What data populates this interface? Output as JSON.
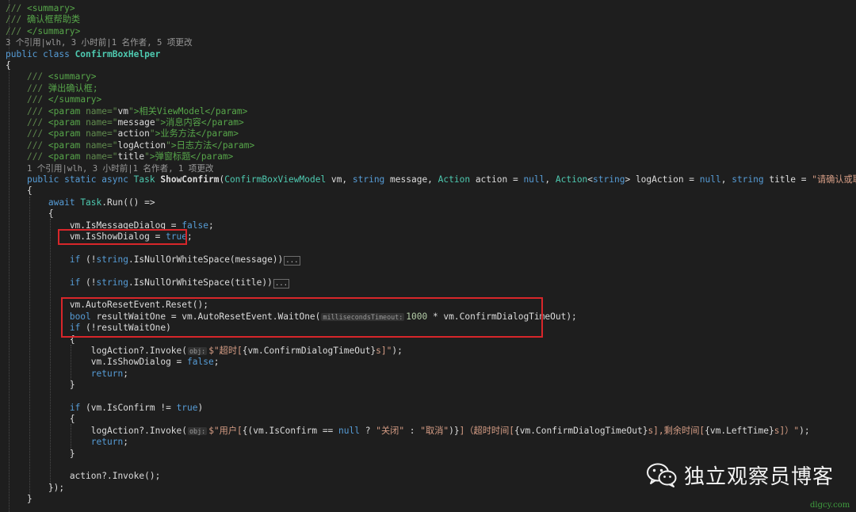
{
  "code_lines": [
    [
      {
        "c": "dt",
        "t": "/// "
      },
      {
        "c": "cm",
        "t": "<summary>"
      }
    ],
    [
      {
        "c": "dt",
        "t": "/// "
      },
      {
        "c": "cm",
        "t": "确认框帮助类"
      }
    ],
    [
      {
        "c": "dt",
        "t": "/// "
      },
      {
        "c": "cm",
        "t": "</summary>"
      }
    ],
    [
      {
        "c": "ref",
        "t": "3 个引用|wlh, 3 小时前|1 名作者, 5 项更改"
      }
    ],
    [
      {
        "c": "kw",
        "t": "public class "
      },
      {
        "c": "cls",
        "t": "ConfirmBoxHelper"
      }
    ],
    [
      {
        "c": "tx",
        "t": "{"
      }
    ],
    [
      {
        "c": "tx",
        "t": "    "
      },
      {
        "c": "dt",
        "t": "/// "
      },
      {
        "c": "cm",
        "t": "<summary>"
      }
    ],
    [
      {
        "c": "tx",
        "t": "    "
      },
      {
        "c": "dt",
        "t": "/// "
      },
      {
        "c": "cm",
        "t": "弹出确认框;"
      }
    ],
    [
      {
        "c": "tx",
        "t": "    "
      },
      {
        "c": "dt",
        "t": "/// "
      },
      {
        "c": "cm",
        "t": "</summary>"
      }
    ],
    [
      {
        "c": "tx",
        "t": "    "
      },
      {
        "c": "dt",
        "t": "/// "
      },
      {
        "c": "cm",
        "t": "<param "
      },
      {
        "c": "dt",
        "t": "name=\""
      },
      {
        "c": "tx",
        "t": "vm"
      },
      {
        "c": "dt",
        "t": "\""
      },
      {
        "c": "cm",
        "t": ">相关ViewModel</param>"
      }
    ],
    [
      {
        "c": "tx",
        "t": "    "
      },
      {
        "c": "dt",
        "t": "/// "
      },
      {
        "c": "cm",
        "t": "<param "
      },
      {
        "c": "dt",
        "t": "name=\""
      },
      {
        "c": "tx",
        "t": "message"
      },
      {
        "c": "dt",
        "t": "\""
      },
      {
        "c": "cm",
        "t": ">消息内容</param>"
      }
    ],
    [
      {
        "c": "tx",
        "t": "    "
      },
      {
        "c": "dt",
        "t": "/// "
      },
      {
        "c": "cm",
        "t": "<param "
      },
      {
        "c": "dt",
        "t": "name=\""
      },
      {
        "c": "tx",
        "t": "action"
      },
      {
        "c": "dt",
        "t": "\""
      },
      {
        "c": "cm",
        "t": ">业务方法</param>"
      }
    ],
    [
      {
        "c": "tx",
        "t": "    "
      },
      {
        "c": "dt",
        "t": "/// "
      },
      {
        "c": "cm",
        "t": "<param "
      },
      {
        "c": "dt",
        "t": "name=\""
      },
      {
        "c": "tx",
        "t": "logAction"
      },
      {
        "c": "dt",
        "t": "\""
      },
      {
        "c": "cm",
        "t": ">日志方法</param>"
      }
    ],
    [
      {
        "c": "tx",
        "t": "    "
      },
      {
        "c": "dt",
        "t": "/// "
      },
      {
        "c": "cm",
        "t": "<param "
      },
      {
        "c": "dt",
        "t": "name=\""
      },
      {
        "c": "tx",
        "t": "title"
      },
      {
        "c": "dt",
        "t": "\""
      },
      {
        "c": "cm",
        "t": ">弹窗标题</param>"
      }
    ],
    [
      {
        "c": "tx",
        "t": "    "
      },
      {
        "c": "ref",
        "t": "1 个引用|wlh, 3 小时前|1 名作者, 1 项更改"
      }
    ],
    [
      {
        "c": "tx",
        "t": "    "
      },
      {
        "c": "kw",
        "t": "public static async "
      },
      {
        "c": "ty",
        "t": "Task "
      },
      {
        "c": "mb",
        "t": "ShowConfirm"
      },
      {
        "c": "tx",
        "t": "("
      },
      {
        "c": "ty",
        "t": "ConfirmBoxViewModel"
      },
      {
        "c": "tx",
        "t": " vm, "
      },
      {
        "c": "kw",
        "t": "string"
      },
      {
        "c": "tx",
        "t": " message, "
      },
      {
        "c": "ty",
        "t": "Action"
      },
      {
        "c": "tx",
        "t": " action = "
      },
      {
        "c": "kw",
        "t": "null"
      },
      {
        "c": "tx",
        "t": ", "
      },
      {
        "c": "ty",
        "t": "Action"
      },
      {
        "c": "tx",
        "t": "<"
      },
      {
        "c": "kw",
        "t": "string"
      },
      {
        "c": "tx",
        "t": "> logAction = "
      },
      {
        "c": "kw",
        "t": "null"
      },
      {
        "c": "tx",
        "t": ", "
      },
      {
        "c": "kw",
        "t": "string"
      },
      {
        "c": "tx",
        "t": " title = "
      },
      {
        "c": "st",
        "t": "\"请确认或取消\""
      },
      {
        "c": "tx",
        "t": ")"
      }
    ],
    [
      {
        "c": "tx",
        "t": "    {"
      }
    ],
    [
      {
        "c": "tx",
        "t": "        "
      },
      {
        "c": "kw",
        "t": "await "
      },
      {
        "c": "ty",
        "t": "Task"
      },
      {
        "c": "tx",
        "t": ".Run(() =>"
      }
    ],
    [
      {
        "c": "tx",
        "t": "        {"
      }
    ],
    [
      {
        "c": "tx",
        "t": "            vm.IsMessageDialog = "
      },
      {
        "c": "kw",
        "t": "false"
      },
      {
        "c": "tx",
        "t": ";"
      }
    ],
    [
      {
        "c": "tx",
        "t": "            vm.IsShowDialog = "
      },
      {
        "c": "kw",
        "t": "true"
      },
      {
        "c": "tx",
        "t": ";"
      }
    ],
    [],
    [
      {
        "c": "tx",
        "t": "            "
      },
      {
        "c": "kw",
        "t": "if"
      },
      {
        "c": "tx",
        "t": " (!"
      },
      {
        "c": "kw",
        "t": "string"
      },
      {
        "c": "tx",
        "t": ".IsNullOrWhiteSpace(message))"
      },
      {
        "c": "col",
        "t": "..."
      }
    ],
    [],
    [
      {
        "c": "tx",
        "t": "            "
      },
      {
        "c": "kw",
        "t": "if"
      },
      {
        "c": "tx",
        "t": " (!"
      },
      {
        "c": "kw",
        "t": "string"
      },
      {
        "c": "tx",
        "t": ".IsNullOrWhiteSpace(title))"
      },
      {
        "c": "col",
        "t": "..."
      }
    ],
    [],
    [
      {
        "c": "tx",
        "t": "            vm.AutoResetEvent.Reset();"
      }
    ],
    [
      {
        "c": "tx",
        "t": "            "
      },
      {
        "c": "kw",
        "t": "bool"
      },
      {
        "c": "tx",
        "t": " resultWaitOne = vm.AutoResetEvent.WaitOne("
      },
      {
        "c": "hint",
        "t": "millisecondsTimeout:"
      },
      {
        "c": "nu",
        "t": "1000"
      },
      {
        "c": "tx",
        "t": " * vm.ConfirmDialogTimeOut);"
      }
    ],
    [
      {
        "c": "tx",
        "t": "            "
      },
      {
        "c": "kw",
        "t": "if"
      },
      {
        "c": "tx",
        "t": " (!resultWaitOne)"
      }
    ],
    [
      {
        "c": "tx",
        "t": "            {"
      }
    ],
    [
      {
        "c": "tx",
        "t": "                logAction?.Invoke("
      },
      {
        "c": "hint",
        "t": "obj:"
      },
      {
        "c": "st",
        "t": "$\"超时["
      },
      {
        "c": "tx",
        "t": "{vm.ConfirmDialogTimeOut}"
      },
      {
        "c": "st",
        "t": "s]\""
      },
      {
        "c": "tx",
        "t": ");"
      }
    ],
    [
      {
        "c": "tx",
        "t": "                vm.IsShowDialog = "
      },
      {
        "c": "kw",
        "t": "false"
      },
      {
        "c": "tx",
        "t": ";"
      }
    ],
    [
      {
        "c": "tx",
        "t": "                "
      },
      {
        "c": "kw",
        "t": "return"
      },
      {
        "c": "tx",
        "t": ";"
      }
    ],
    [
      {
        "c": "tx",
        "t": "            }"
      }
    ],
    [],
    [
      {
        "c": "tx",
        "t": "            "
      },
      {
        "c": "kw",
        "t": "if"
      },
      {
        "c": "tx",
        "t": " (vm.IsConfirm != "
      },
      {
        "c": "kw",
        "t": "true"
      },
      {
        "c": "tx",
        "t": ")"
      }
    ],
    [
      {
        "c": "tx",
        "t": "            {"
      }
    ],
    [
      {
        "c": "tx",
        "t": "                logAction?.Invoke("
      },
      {
        "c": "hint",
        "t": "obj:"
      },
      {
        "c": "st",
        "t": "$\"用户["
      },
      {
        "c": "tx",
        "t": "{(vm.IsConfirm == "
      },
      {
        "c": "kw",
        "t": "null"
      },
      {
        "c": "tx",
        "t": " ? "
      },
      {
        "c": "st",
        "t": "\"关闭\""
      },
      {
        "c": "tx",
        "t": " : "
      },
      {
        "c": "st",
        "t": "\"取消\""
      },
      {
        "c": "tx",
        "t": ")}"
      },
      {
        "c": "st",
        "t": "]（超时时间["
      },
      {
        "c": "tx",
        "t": "{vm.ConfirmDialogTimeOut}"
      },
      {
        "c": "st",
        "t": "s],剩余时间["
      },
      {
        "c": "tx",
        "t": "{vm.LeftTime}"
      },
      {
        "c": "st",
        "t": "s]）\""
      },
      {
        "c": "tx",
        "t": ");"
      }
    ],
    [
      {
        "c": "tx",
        "t": "                "
      },
      {
        "c": "kw",
        "t": "return"
      },
      {
        "c": "tx",
        "t": ";"
      }
    ],
    [
      {
        "c": "tx",
        "t": "            }"
      }
    ],
    [],
    [
      {
        "c": "tx",
        "t": "            action?.Invoke();"
      }
    ],
    [
      {
        "c": "tx",
        "t": "        });"
      }
    ],
    [
      {
        "c": "tx",
        "t": "    }"
      }
    ]
  ],
  "watermark": {
    "text": "独立观察员博客",
    "icon": "wechat-icon",
    "site": "dlgcy.com"
  },
  "colors": {
    "background": "#1e1e1e",
    "highlight_border": "#d8262a",
    "watermark_site": "#3f9e3f"
  }
}
